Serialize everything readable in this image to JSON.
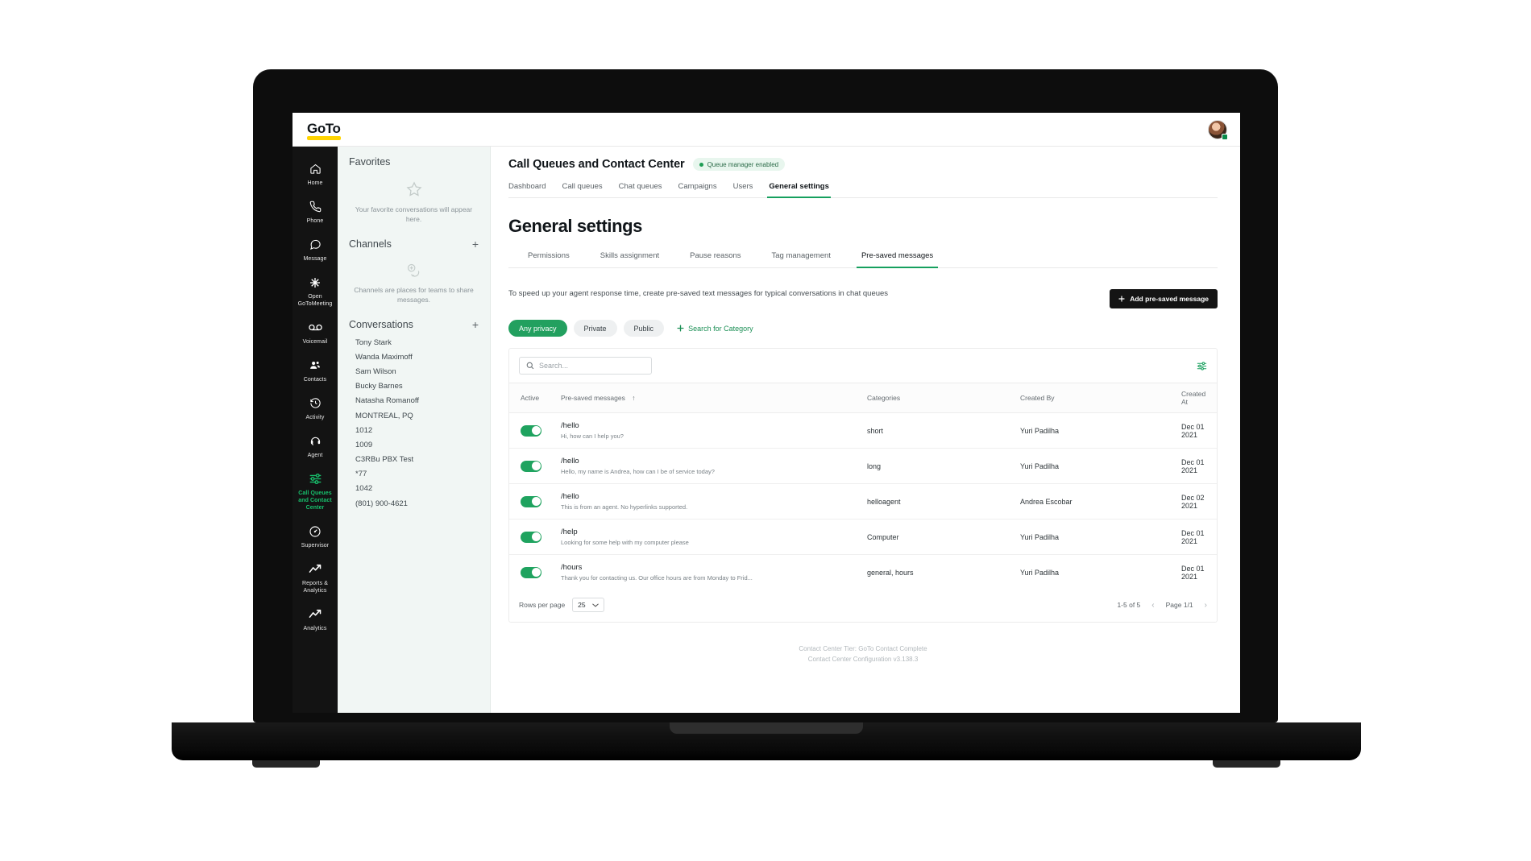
{
  "brand": {
    "logo_text": "GoTo",
    "accent_green": "#16a05e",
    "accent_yellow": "#ffd400",
    "dark": "#141414"
  },
  "topbar": {
    "logo": "GoTo",
    "avatar_name": "user-avatar",
    "presence": "available"
  },
  "rail": {
    "items": [
      {
        "icon": "home-icon",
        "label": "Home",
        "active": false
      },
      {
        "icon": "phone-icon",
        "label": "Phone",
        "active": false
      },
      {
        "icon": "message-icon",
        "label": "Message",
        "active": false
      },
      {
        "icon": "meeting-icon",
        "label": "Open GoToMeeting",
        "active": false
      },
      {
        "icon": "voicemail-icon",
        "label": "Voicemail",
        "active": false
      },
      {
        "icon": "contacts-icon",
        "label": "Contacts",
        "active": false
      },
      {
        "icon": "activity-icon",
        "label": "Activity",
        "active": false
      },
      {
        "icon": "agent-icon",
        "label": "Agent",
        "active": false
      },
      {
        "icon": "sliders-icon",
        "label": "Call Queues and Contact Center",
        "active": true
      },
      {
        "icon": "supervisor-icon",
        "label": "Supervisor",
        "active": false
      },
      {
        "icon": "reports-icon",
        "label": "Reports & Analytics",
        "active": false
      },
      {
        "icon": "analytics-icon",
        "label": "Analytics",
        "active": false
      }
    ]
  },
  "convpanel": {
    "favorites": {
      "title": "Favorites",
      "empty_text": "Your favorite conversations will appear here.",
      "icon": "star-icon"
    },
    "channels": {
      "title": "Channels",
      "empty_text": "Channels are places for teams to share messages.",
      "icon": "add-channel-icon",
      "add_label": "+"
    },
    "conversations": {
      "title": "Conversations",
      "add_label": "+",
      "items": [
        "Tony Stark",
        "Wanda Maximoff",
        "Sam Wilson",
        "Bucky Barnes",
        "Natasha Romanoff",
        "MONTREAL, PQ",
        "1012",
        "1009",
        "C3RBu PBX Test",
        "*77",
        "1042",
        "(801) 900-4621"
      ]
    }
  },
  "main": {
    "header": {
      "title": "Call Queues and Contact Center",
      "badge": "Queue manager enabled"
    },
    "tabs": [
      {
        "label": "Dashboard",
        "active": false
      },
      {
        "label": "Call queues",
        "active": false
      },
      {
        "label": "Chat queues",
        "active": false
      },
      {
        "label": "Campaigns",
        "active": false
      },
      {
        "label": "Users",
        "active": false
      },
      {
        "label": "General settings",
        "active": true
      }
    ],
    "page_title": "General settings",
    "subtabs": [
      {
        "label": "Permissions",
        "active": false
      },
      {
        "label": "Skills assignment",
        "active": false
      },
      {
        "label": "Pause reasons",
        "active": false
      },
      {
        "label": "Tag management",
        "active": false
      },
      {
        "label": "Pre-saved messages",
        "active": true
      }
    ],
    "blurb": "To speed up your agent response time, create pre-saved text messages for typical conversations in chat queues",
    "add_button": "Add pre-saved message",
    "filters": {
      "chips": [
        {
          "label": "Any privacy",
          "active": true
        },
        {
          "label": "Private",
          "active": false
        },
        {
          "label": "Public",
          "active": false
        }
      ],
      "category_link": "Search for Category"
    },
    "search": {
      "placeholder": "Search...",
      "value": ""
    },
    "filter_icon": "filter-sliders-icon",
    "table": {
      "columns": [
        "Active",
        "Pre-saved messages",
        "Categories",
        "Created By",
        "Created At"
      ],
      "sort_column": "Pre-saved messages",
      "sort_direction": "↑",
      "rows": [
        {
          "active": true,
          "command": "/hello",
          "preview": "Hi, how can I help you?",
          "categories": "short",
          "created_by": "Yuri Padilha",
          "created_at": "Dec 01 2021"
        },
        {
          "active": true,
          "command": "/hello",
          "preview": "Hello, my name is Andrea, how can I be of service today?",
          "categories": "long",
          "created_by": "Yuri Padilha",
          "created_at": "Dec 01 2021"
        },
        {
          "active": true,
          "command": "/hello",
          "preview": "This is from an agent. No hyperlinks supported.",
          "categories": "helloagent",
          "created_by": "Andrea Escobar",
          "created_at": "Dec 02 2021"
        },
        {
          "active": true,
          "command": "/help",
          "preview": "Looking for some help with my computer please",
          "categories": "Computer",
          "created_by": "Yuri Padilha",
          "created_at": "Dec 01 2021"
        },
        {
          "active": true,
          "command": "/hours",
          "preview": "Thank you for contacting us. Our office hours are from Monday to Frid...",
          "categories": "general, hours",
          "created_by": "Yuri Padilha",
          "created_at": "Dec 01 2021"
        }
      ]
    },
    "pagination": {
      "rows_per_page_label": "Rows per page",
      "rows_per_page_value": "25",
      "range": "1-5 of 5",
      "page": "Page 1/1",
      "prev": "‹",
      "next": "›"
    },
    "footnote_line1": "Contact Center Tier: GoTo Contact Complete",
    "footnote_line2": "Contact Center Configuration v3.138.3"
  }
}
